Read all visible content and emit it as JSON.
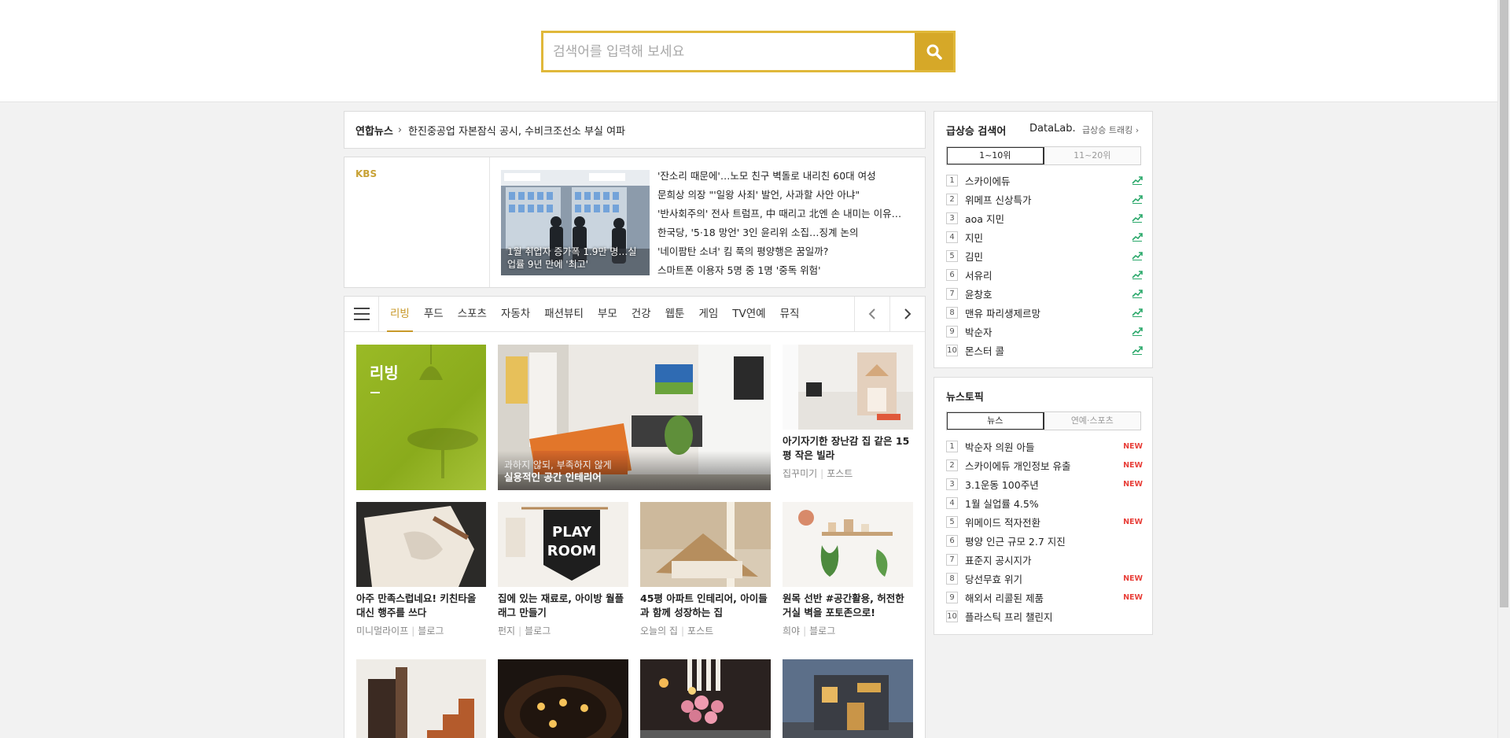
{
  "search": {
    "placeholder": "검색어를 입력해 보세요"
  },
  "ticker": {
    "source": "연합뉴스",
    "headline": "한진중공업 자본잠식 공시, 수비크조선소 부실 여파"
  },
  "kbs": {
    "brand": "KBS",
    "thumb_caption": "1월 취업자 증가폭 1.9만 명…실업률 9년 만에 '최고'",
    "headlines": [
      "'잔소리 때문에'…노모 친구 벽돌로 내리친 60대 여성",
      "문희상 의장 \"'일왕 사죄' 발언, 사과할 사안 아냐\"",
      "'반사회주의' 전사 트럼프, 中 때리고 北엔 손 내미는 이유…",
      "한국당, '5·18 망언' 3인 윤리위 소집…징계 논의",
      "'네이팜탄 소녀' 킴 푹의 평양행은 꿈일까?",
      "스마트폰 이용자 5명 중 1명 '중독 위험'"
    ]
  },
  "tabs": [
    "리빙",
    "푸드",
    "스포츠",
    "자동차",
    "패션뷰티",
    "부모",
    "건강",
    "웹툰",
    "게임",
    "TV연예",
    "뮤직"
  ],
  "living": {
    "label": "리빙",
    "big": {
      "sub": "과하지 않되, 부족하지 않게",
      "title": "실용적인 공간 인테리어"
    },
    "cards": [
      {
        "title": "아기자기한 장난감 집 같은 15평 작은 빌라",
        "source": "집꾸미기",
        "type": "포스트"
      },
      {
        "title": "아주 만족스럽네요! 키친타올 대신 행주를 쓰다",
        "source": "미니멀라이프",
        "type": "블로그"
      },
      {
        "title": "집에 있는 재료로, 아이방 월플래그 만들기",
        "source": "펀지",
        "type": "블로그",
        "flag_text": [
          "PLAY",
          "ROOM"
        ]
      },
      {
        "title": "45평 아파트 인테리어, 아이들과 함께 성장하는 집",
        "source": "오늘의 집",
        "type": "포스트"
      },
      {
        "title": "원목 선반 #공간활용, 허전한 거실 벽을 포토존으로!",
        "source": "희야",
        "type": "블로그"
      }
    ]
  },
  "rank": {
    "title": "급상승 검색어",
    "datalab": "DataLab.",
    "datalab_sub": "급상승 트래킹",
    "seg": [
      "1~10위",
      "11~20위"
    ],
    "items": [
      "스카이에듀",
      "위메프 신상특가",
      "aoa 지민",
      "지민",
      "김민",
      "서유리",
      "윤창호",
      "맨유 파리생제르망",
      "박순자",
      "몬스터 콜"
    ]
  },
  "topic": {
    "title": "뉴스토픽",
    "seg": [
      "뉴스",
      "연예·스포츠"
    ],
    "new_label": "NEW",
    "items": [
      {
        "text": "박순자 의원 아들",
        "new": true
      },
      {
        "text": "스카이에듀 개인정보 유출",
        "new": true
      },
      {
        "text": "3.1운동 100주년",
        "new": true
      },
      {
        "text": "1월 실업률 4.5%",
        "new": false
      },
      {
        "text": "위메이드 적자전환",
        "new": true
      },
      {
        "text": "평양 인근 규모 2.7 지진",
        "new": false
      },
      {
        "text": "표준지 공시지가",
        "new": false
      },
      {
        "text": "당선무효 위기",
        "new": true
      },
      {
        "text": "해외서 리콜된 제품",
        "new": true
      },
      {
        "text": "플라스틱 프리 챌린지",
        "new": false
      }
    ]
  },
  "colors": {
    "accent": "#d6a828",
    "living_green": "#9aba26",
    "trend_green": "#2aa86a",
    "new_red": "#e8403a"
  }
}
